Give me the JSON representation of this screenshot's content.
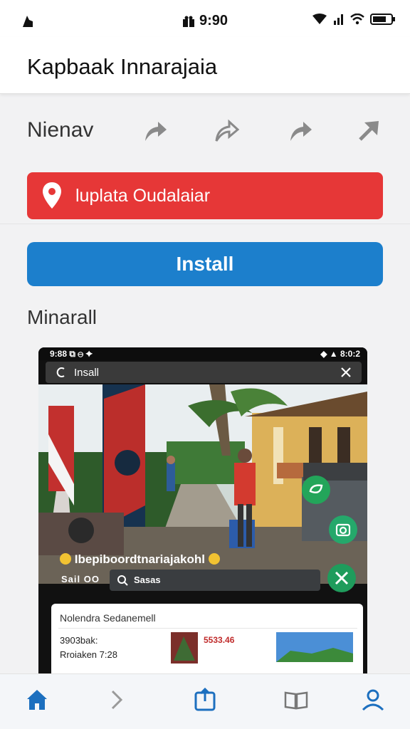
{
  "status_bar": {
    "time": "9:90"
  },
  "header": {
    "title": "Kapbaak Innarajaia"
  },
  "share": {
    "label": "Nienav"
  },
  "location": {
    "label": "luplata Oudalaiar"
  },
  "install": {
    "label": "Install"
  },
  "section": {
    "heading": "Minarall"
  },
  "preview": {
    "status_left": "9:88 ⧉ ⊖ ✦",
    "status_right": "◆ ▲ 8:0:2",
    "search_label": "Insall",
    "info_title": "Ibepiboordtnariajakohl",
    "info_sub": "Sail  OO",
    "search2_label": "Sasas",
    "card": {
      "title": "Nolendra Sedanemell",
      "line1": "3903bak:",
      "line2": "Rroiaken 7:28",
      "price": "5533.46"
    }
  },
  "colors": {
    "location_red": "#e63737",
    "install_blue": "#1c7fcc",
    "nav_active": "#1c6fbf",
    "fab_green": "#20a66a"
  },
  "icons": {
    "share": "share-arrow-icon",
    "location": "map-pin-icon",
    "nav": [
      "home-icon",
      "chevron-right-icon",
      "share-box-icon",
      "book-icon",
      "person-icon"
    ]
  }
}
